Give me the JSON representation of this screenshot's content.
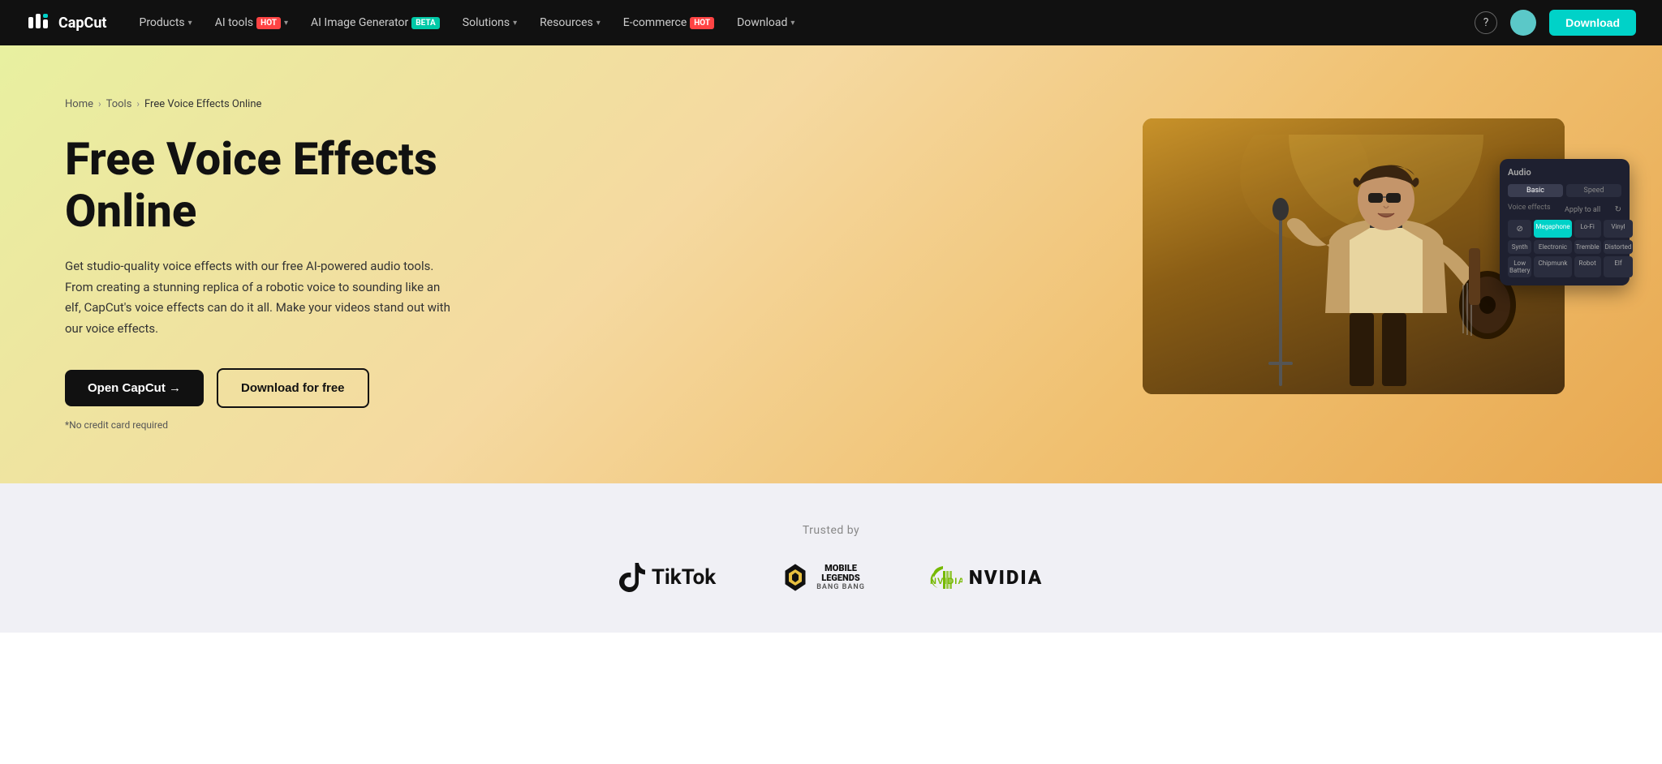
{
  "navbar": {
    "logo_text": "CapCut",
    "nav_items": [
      {
        "label": "Products",
        "has_chevron": true,
        "badge": null
      },
      {
        "label": "AI tools",
        "has_chevron": true,
        "badge": "Hot",
        "badge_type": "hot"
      },
      {
        "label": "AI Image Generator",
        "has_chevron": false,
        "badge": "Beta",
        "badge_type": "beta"
      },
      {
        "label": "Solutions",
        "has_chevron": true,
        "badge": null
      },
      {
        "label": "Resources",
        "has_chevron": true,
        "badge": null
      },
      {
        "label": "E-commerce",
        "has_chevron": false,
        "badge": "Hot",
        "badge_type": "hot"
      },
      {
        "label": "Download",
        "has_chevron": true,
        "badge": null
      }
    ],
    "download_btn": "Download"
  },
  "breadcrumb": {
    "home": "Home",
    "tools": "Tools",
    "current": "Free Voice Effects Online"
  },
  "hero": {
    "title": "Free Voice Effects Online",
    "description": "Get studio-quality voice effects with our free AI-powered audio tools. From creating a stunning replica of a robotic voice to sounding like an elf, CapCut's voice effects can do it all. Make your videos stand out with our voice effects.",
    "btn_primary": "Open CapCut →",
    "btn_secondary": "Download for free",
    "no_credit": "*No credit card required"
  },
  "ui_panel": {
    "header": "Audio",
    "tabs": [
      "Basic",
      "Speed"
    ],
    "active_tab": "Basic",
    "section_label": "Voice effects",
    "apply_all": "Apply to all",
    "effects": [
      {
        "label": "Megaphone",
        "active": true
      },
      {
        "label": "Lo-Fi",
        "active": false
      },
      {
        "label": "Vinyl",
        "active": false
      },
      {
        "label": "Synth",
        "active": false
      },
      {
        "label": "Electronic",
        "active": false
      },
      {
        "label": "Tremble",
        "active": false
      },
      {
        "label": "Distorted",
        "active": false
      },
      {
        "label": "Low Battery",
        "active": false
      },
      {
        "label": "Chipmunk",
        "active": false
      },
      {
        "label": "Robot",
        "active": false
      },
      {
        "label": "Elf",
        "active": false
      }
    ]
  },
  "trusted": {
    "label": "Trusted by",
    "logos": [
      "TikTok",
      "Mobile Legends",
      "NVIDIA"
    ]
  }
}
